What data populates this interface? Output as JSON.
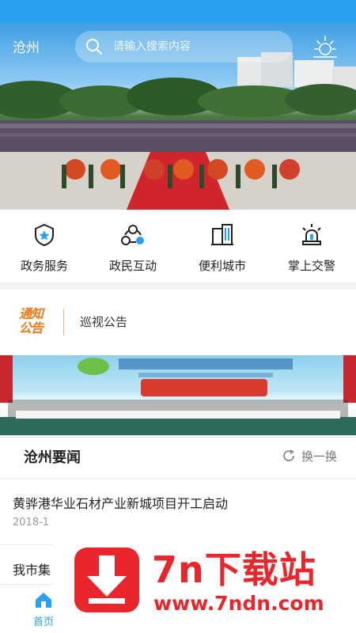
{
  "header": {
    "city": "沧州",
    "search_placeholder": "请输入搜索内容",
    "accent_color": "#2ba0f0"
  },
  "quick_menu": [
    {
      "label": "政务服务",
      "icon": "shield-star-icon"
    },
    {
      "label": "政民互动",
      "icon": "network-icon"
    },
    {
      "label": "便利城市",
      "icon": "buildings-icon"
    },
    {
      "label": "掌上交警",
      "icon": "police-light-icon"
    }
  ],
  "notice": {
    "logo_line1": "通知",
    "logo_line2": "公告",
    "text": "巡视公告"
  },
  "news": {
    "section_title": "沧州要闻",
    "refresh_label": "换一换",
    "items": [
      {
        "title": "黄骅港华业石材产业新城项目开工启动",
        "date": "2018-1"
      },
      {
        "title": "我市集"
      }
    ]
  },
  "tabbar": {
    "home_label": "首页"
  },
  "watermark": {
    "name": "7n下载站",
    "url": "www.7ndn.com"
  }
}
